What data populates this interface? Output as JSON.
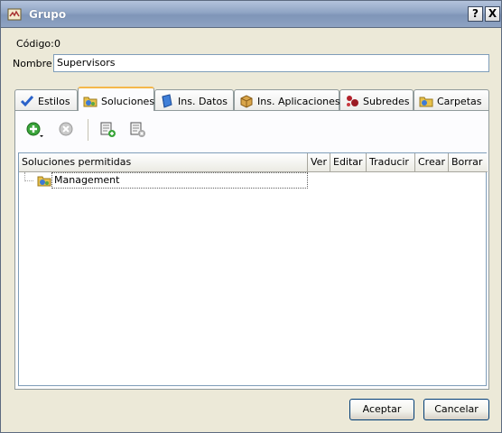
{
  "window": {
    "title": "Grupo",
    "help_glyph": "?",
    "close_glyph": "X"
  },
  "form": {
    "codigo_label": "Código:",
    "codigo_value": "0",
    "nombre_label": "Nombre:",
    "nombre_value": "Supervisors"
  },
  "tabs": [
    {
      "label": "Estilos",
      "icon": "checkmark-icon",
      "active": false
    },
    {
      "label": "Soluciones",
      "icon": "solutions-icon",
      "active": true
    },
    {
      "label": "Ins. Datos",
      "icon": "data-book-icon",
      "active": false
    },
    {
      "label": "Ins. Aplicaciones",
      "icon": "package-icon",
      "active": false
    },
    {
      "label": "Subredes",
      "icon": "network-icon",
      "active": false
    },
    {
      "label": "Carpetas",
      "icon": "folder-icon",
      "active": false
    }
  ],
  "toolbar": {
    "add": "add-icon",
    "remove": "remove-icon",
    "add_folder": "add-item-icon",
    "remove_folder": "remove-item-icon"
  },
  "grid": {
    "columns": [
      "Soluciones permitidas",
      "Ver",
      "Editar",
      "Traducir",
      "Crear",
      "Borrar"
    ],
    "rows": [
      {
        "label": "Management",
        "icon": "solution-folder-icon"
      }
    ]
  },
  "buttons": {
    "ok": "Aceptar",
    "cancel": "Cancelar"
  }
}
